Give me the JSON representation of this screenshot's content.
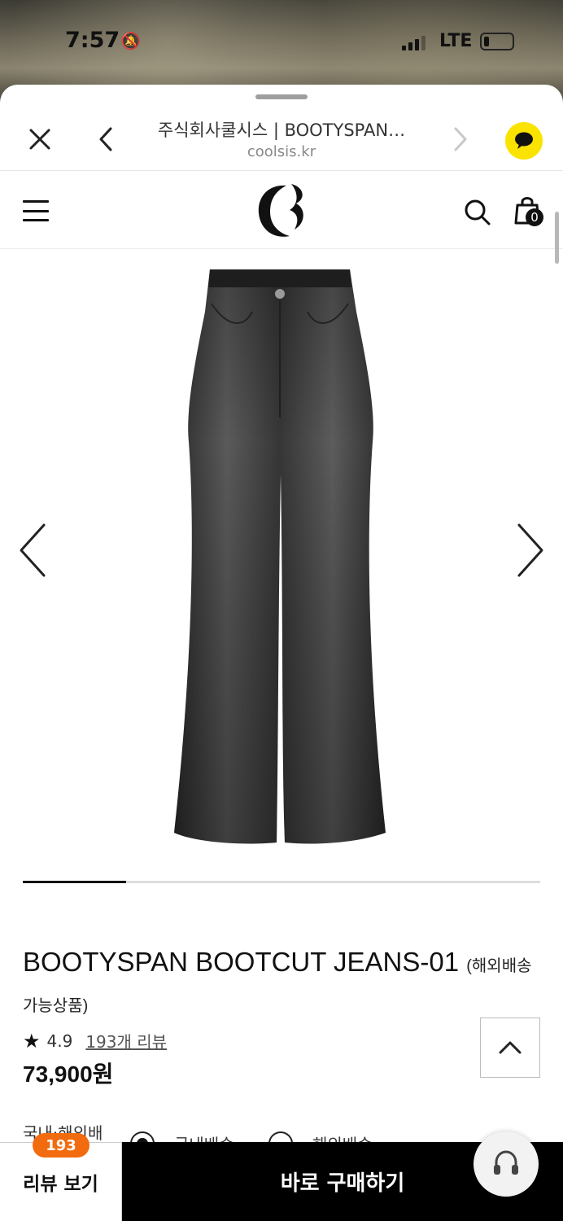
{
  "status_bar": {
    "time": "7:57",
    "network": "LTE"
  },
  "browser": {
    "title": "주식회사쿨시스 | BOOTYSPAN…",
    "url": "coolsis.kr"
  },
  "header": {
    "cart_count": "0"
  },
  "gallery": {
    "progress": 0.2
  },
  "product": {
    "name": "BOOTYSPAN BOOTCUT JEANS-01",
    "note": "(해외배송 가능상품)",
    "rating": "4.9",
    "reviews_link": "193개 리뷰",
    "price": "73,900원"
  },
  "shipping": {
    "label": "국내·해외배",
    "option_domestic": "국내배송",
    "option_overseas": "해외배송"
  },
  "bottom": {
    "review_label": "리뷰 보기",
    "review_count": "193",
    "buy_label": "바로 구매하기"
  },
  "colors": {
    "accent_orange": "#f26b0f",
    "kakao_yellow": "#fbe300"
  },
  "icons": [
    "close-icon",
    "back-chevron-icon",
    "forward-chevron-icon",
    "chat-icon",
    "menu-icon",
    "search-icon",
    "cart-icon",
    "star-icon",
    "chevron-up-icon",
    "headset-icon"
  ]
}
